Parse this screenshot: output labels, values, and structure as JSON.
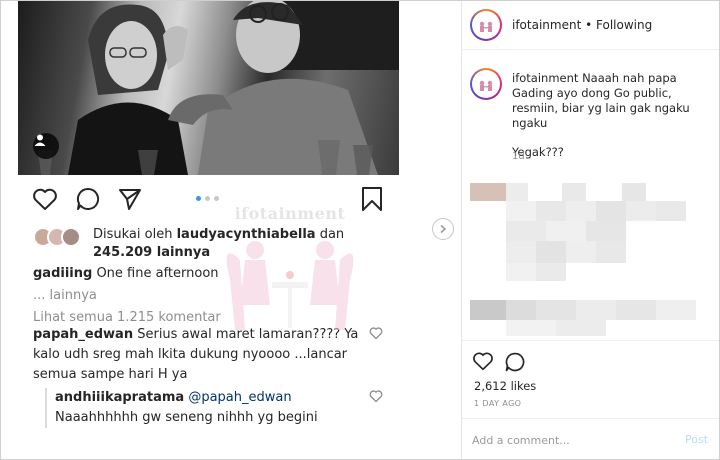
{
  "left_post": {
    "liked_by_prefix": "Disukai oleh",
    "liked_by_user": "laudyacynthiabella",
    "liked_by_and": "dan",
    "likes_others": "245.209 lainnya",
    "caption_user": "gadiiing",
    "caption_text": "One fine afternoon",
    "caption_more": "... lainnya",
    "view_comments": "Lihat semua 1.215 komentar",
    "comment1_user": "papah_edwan",
    "comment1_text": "Serius awal maret lamaran???? Ya kalo udh sreg mah lkita dukung nyoooo ...lancar semua sampe hari H ya",
    "reply_user": "andhiiikapratama",
    "reply_mention": "@papah_edwan",
    "reply_text": "Naaahhhhhh gw seneng nihhh yg begini",
    "carousel_dots": 3,
    "carousel_active": 1
  },
  "watermark": {
    "text": "ifotainment"
  },
  "right_panel": {
    "account": "ifotainment",
    "separator": "•",
    "follow_status": "Following",
    "caption_user": "ifotainment",
    "caption_text": "Naaah nah papa Gading ayo dong Go public, resmiin, biar yg lain gak ngaku ngaku",
    "caption_extra": "Yegak???",
    "caption_time": "1d",
    "likes": "2,612 likes",
    "time_ago": "1 DAY AGO",
    "add_comment_placeholder": "Add a comment...",
    "post_label": "Post"
  },
  "icons": {
    "heart": "heart-icon",
    "comment": "comment-icon",
    "share": "share-icon",
    "bookmark": "bookmark-icon",
    "user_tag": "user-icon",
    "next": "chevron-right-icon"
  },
  "colors": {
    "link_blue": "#3897f0",
    "text": "#262626",
    "muted": "#8e8e8e",
    "post_disabled": "#b2dffc",
    "mention": "#003569"
  }
}
